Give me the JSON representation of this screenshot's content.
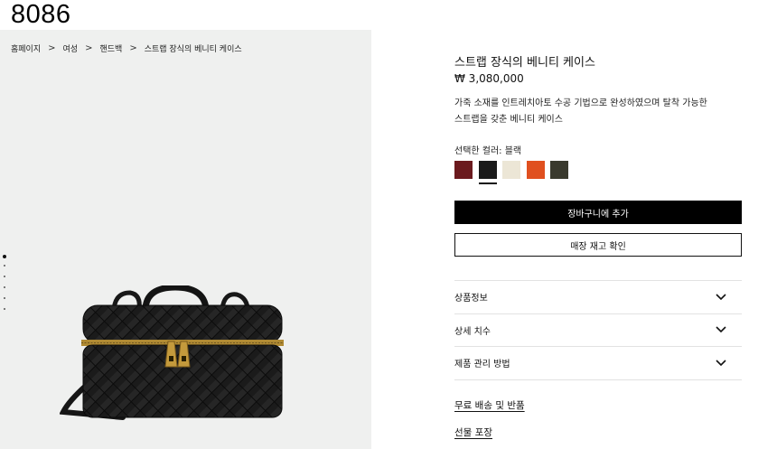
{
  "code_label": "8086",
  "breadcrumb": {
    "items": [
      "홈페이지",
      "여성",
      "핸드백",
      "스트랩 장식의 베니티 케이스"
    ],
    "separator": ">"
  },
  "product": {
    "title": "스트랩 장식의 베니티 케이스",
    "price": "₩ 3,080,000",
    "description_line1": "가죽 소재를 인트레치아토 수공 기법으로 완성하였으며 탈착 가능한",
    "description_line2": "스트랩을 갖춘 베니티 케이스",
    "selected_color_label": "선택한 컬러: 블랙"
  },
  "swatches": [
    {
      "name": "dark-red",
      "color": "#6b1a1e"
    },
    {
      "name": "black",
      "color": "#1a1a1a",
      "selected": true
    },
    {
      "name": "cream",
      "color": "#ece6d6"
    },
    {
      "name": "orange",
      "color": "#e0501f"
    },
    {
      "name": "dark-olive",
      "color": "#3a3a2e"
    }
  ],
  "buttons": {
    "add_to_cart": "장바구니에 추가",
    "store_stock": "매장 재고 확인"
  },
  "accordion": [
    "상품정보",
    "상세 치수",
    "제품 관리 방법"
  ],
  "links": {
    "shipping": "무료 배송 및 반품",
    "gift": "선물 포장"
  },
  "colors": {
    "gallery_bg": "#eff0ef",
    "accent": "#000000"
  },
  "gallery": {
    "slide_count": 6,
    "active_slide": 1
  }
}
